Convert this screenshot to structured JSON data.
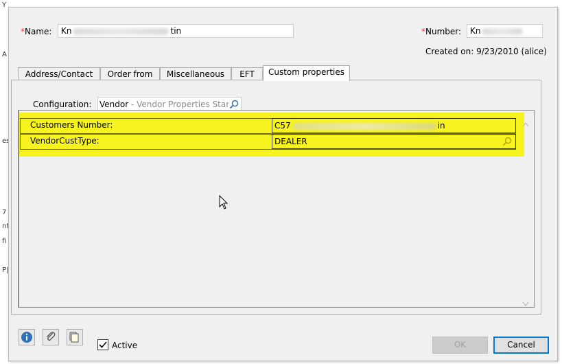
{
  "background_text": [
    "Y",
    "A",
    "es",
    "7",
    "nt",
    "fi",
    "P|"
  ],
  "name_label": "Name:",
  "name_value_prefix": "Kn",
  "name_value_suffix": "tin",
  "number_label": "Number:",
  "number_value_prefix": "Kn",
  "required_mark": "*",
  "created_on": "Created on: 9/23/2010 (alice)",
  "tabs": [
    {
      "label": "Address/Contact",
      "active": false
    },
    {
      "label": "Order from",
      "active": false
    },
    {
      "label": "Miscellaneous",
      "active": false
    },
    {
      "label": "EFT",
      "active": false
    },
    {
      "label": "Custom properties",
      "active": true
    }
  ],
  "configuration": {
    "label": "Configuration:",
    "value": "Vendor",
    "description": " - Vendor Properties Stan"
  },
  "custom_properties": [
    {
      "name": "Customers Number:",
      "value_prefix": "C57",
      "value_suffix": "in"
    },
    {
      "name": "VendorCustType:",
      "value": "DEALER"
    }
  ],
  "highlight_color": "#f7f200",
  "footer": {
    "active_label": "Active",
    "active_checked": true,
    "ok_label": "OK",
    "cancel_label": "Cancel"
  },
  "icons": [
    "info-icon",
    "attachment-icon",
    "notes-icon",
    "search-icon",
    "mouse-cursor-icon"
  ]
}
